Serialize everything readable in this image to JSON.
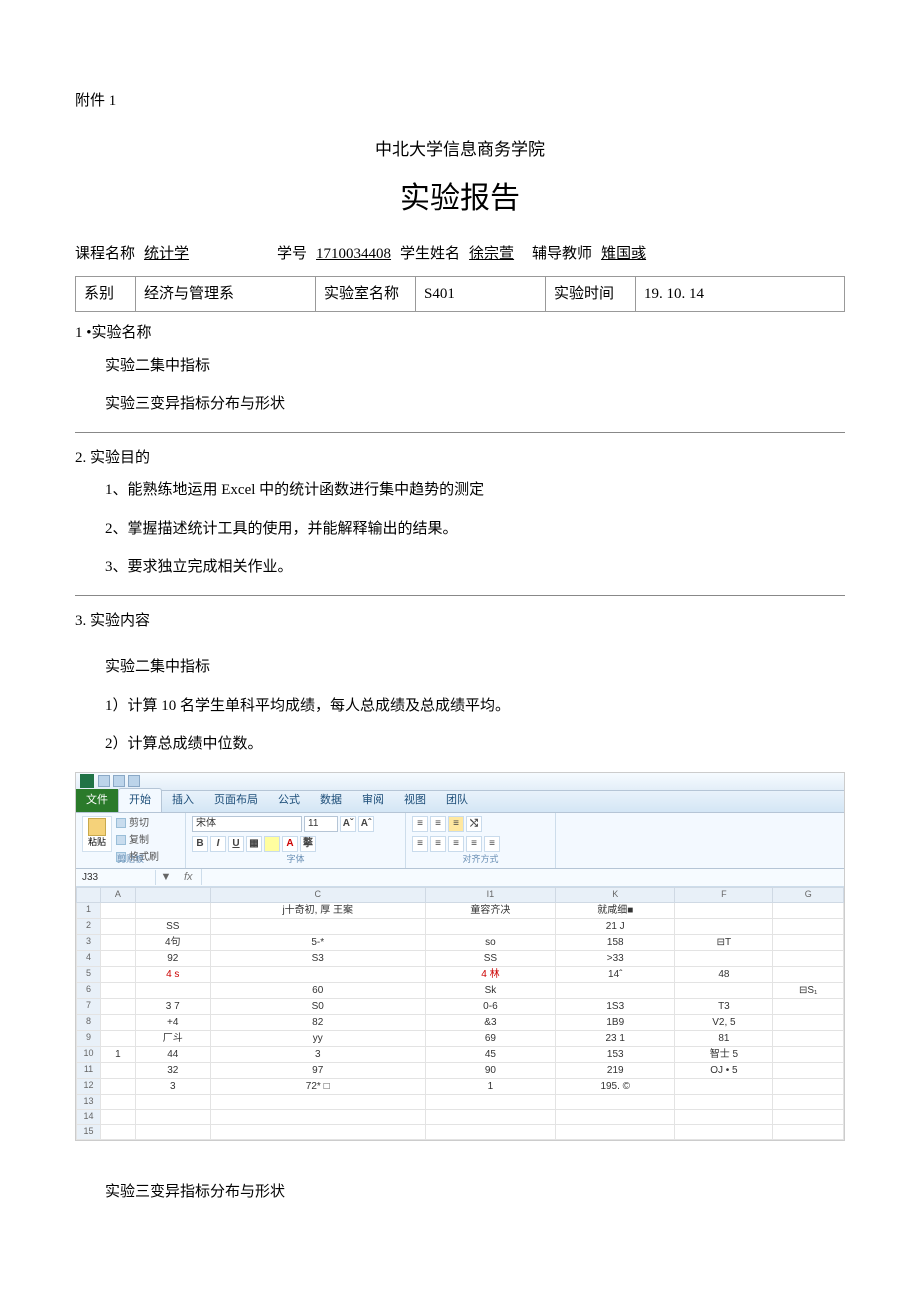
{
  "header": {
    "attachment": "附件 1",
    "university": "中北大学信息商务学院",
    "report_title": "实验报告",
    "course_label": "课程名称",
    "course_value": "统计学",
    "student_id_label": "学号",
    "student_id_value": "1710034408",
    "student_name_label": "学生姓名",
    "student_name_value": "徐宗萱",
    "teacher_label": "辅导教师",
    "teacher_value": "雉国彧"
  },
  "info_table": {
    "dept_label": "系别",
    "dept_value": "经济与管理系",
    "lab_label": "实验室名称",
    "lab_value": "S401",
    "time_label": "实验时间",
    "time_value": "19. 10. 14"
  },
  "sections": {
    "s1_heading": "1 •实验名称",
    "s1_line1": "实验二集中指标",
    "s1_line2": "实验三变异指标分布与形状",
    "s2_heading": "2.  实验目的",
    "s2_line1": "1、能熟练地运用 Excel 中的统计函数进行集中趋势的测定",
    "s2_line2": "2、掌握描述统计工具的使用，并能解释输出的结果。",
    "s2_line3": "3、要求独立完成相关作业。",
    "s3_heading": "3.  实验内容",
    "s3_line1": "实验二集中指标",
    "s3_line2": "1）计算 10 名学生单科平均成绩，每人总成绩及总成绩平均。",
    "s3_line3": "2）计算总成绩中位数。",
    "s3_line4": "实验三变异指标分布与形状"
  },
  "excel": {
    "tabs": {
      "file": "文件",
      "home": "开始",
      "insert": "插入",
      "layout": "页面布局",
      "formulas": "公式",
      "data": "数据",
      "review": "审阅",
      "view": "视图",
      "team": "团队"
    },
    "clipboard": {
      "paste": "粘贴",
      "cut": "剪切",
      "copy": "复制",
      "format": "格式刷",
      "group": "剪贴板"
    },
    "font": {
      "name": "宋体",
      "size": "11",
      "group": "字体"
    },
    "align": {
      "group": "对齐方式"
    },
    "namebox": "J33",
    "fx": "fx",
    "cols": [
      "",
      "A",
      "",
      "C",
      "I1",
      "K",
      "F",
      "G"
    ],
    "rows": [
      {
        "n": "1",
        "cells": [
          "",
          "",
          "",
          "j十奇初, 厚 王案",
          "童容齐决",
          "就咸细■",
          "",
          ""
        ]
      },
      {
        "n": "2",
        "cells": [
          "",
          "",
          "SS",
          "",
          "",
          "21 J",
          "",
          ""
        ]
      },
      {
        "n": "3",
        "cells": [
          "",
          "",
          "4句",
          "5-*",
          "so",
          "158",
          "⊟T",
          ""
        ]
      },
      {
        "n": "4",
        "cells": [
          "",
          "",
          "92",
          "S3",
          "SS",
          ">33",
          "",
          ""
        ]
      },
      {
        "n": "5",
        "cells": [
          "",
          "",
          "4 s",
          "",
          "4 林",
          "14ˆ",
          "48",
          ""
        ],
        "red": [
          2,
          4
        ]
      },
      {
        "n": "6",
        "cells": [
          "",
          "",
          "",
          "60",
          "Sk",
          "",
          "",
          "⊟S₁"
        ]
      },
      {
        "n": "7",
        "cells": [
          "",
          "",
          "3 7",
          "S0",
          "0-6",
          "1S3",
          "T3",
          ""
        ]
      },
      {
        "n": "8",
        "cells": [
          "",
          "",
          "+4",
          "82",
          "&3",
          "1B9",
          "V2, 5",
          ""
        ]
      },
      {
        "n": "9",
        "cells": [
          "",
          "",
          "厂斗",
          "yy",
          "69",
          "23 1",
          "81",
          ""
        ]
      },
      {
        "n": "10",
        "cells": [
          "",
          "1",
          "44",
          "3",
          "45",
          "153",
          "智士 5",
          ""
        ]
      },
      {
        "n": "11",
        "cells": [
          "",
          "",
          "32",
          "97",
          "90",
          "219",
          "OJ • 5",
          ""
        ]
      },
      {
        "n": "12",
        "cells": [
          "",
          "",
          "3",
          "72* □",
          "1",
          "195. ©",
          "",
          ""
        ]
      },
      {
        "n": "13",
        "cells": [
          "",
          "",
          "",
          "",
          "",
          "",
          "",
          ""
        ]
      },
      {
        "n": "14",
        "cells": [
          "",
          "",
          "",
          "",
          "",
          "",
          "",
          ""
        ]
      },
      {
        "n": "15",
        "cells": [
          "",
          "",
          "",
          "",
          "",
          "",
          "",
          ""
        ]
      }
    ]
  }
}
